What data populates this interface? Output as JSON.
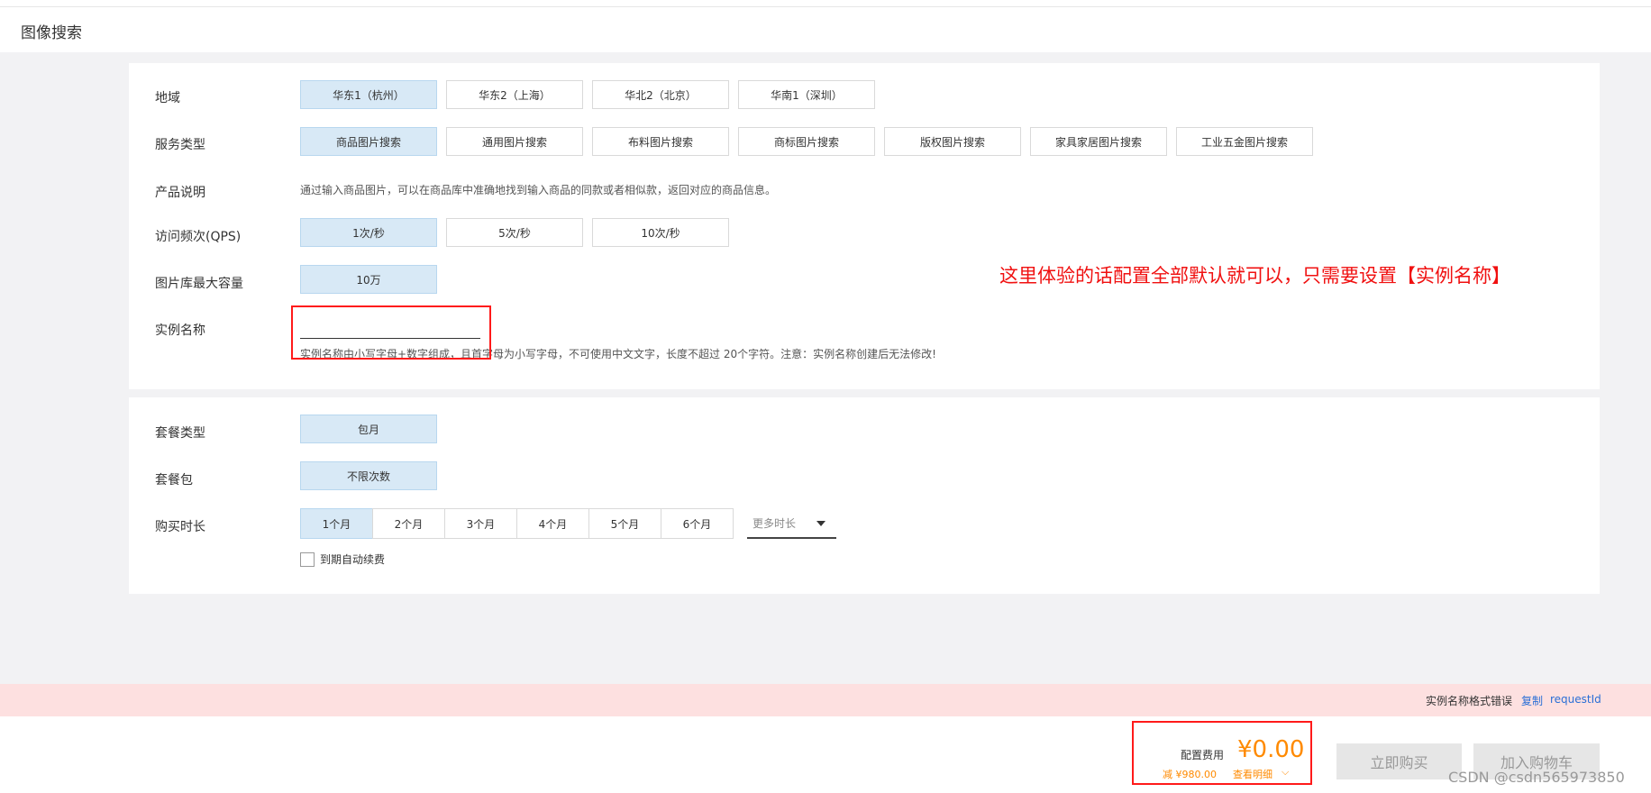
{
  "page": {
    "title": "图像搜索"
  },
  "region": {
    "label": "地域",
    "options": [
      "华东1（杭州）",
      "华东2（上海）",
      "华北2（北京）",
      "华南1（深圳）"
    ]
  },
  "service": {
    "label": "服务类型",
    "options": [
      "商品图片搜索",
      "通用图片搜索",
      "布料图片搜索",
      "商标图片搜索",
      "版权图片搜索",
      "家具家居图片搜索",
      "工业五金图片搜索"
    ]
  },
  "product": {
    "label": "产品说明",
    "description": "通过输入商品图片，可以在商品库中准确地找到输入商品的同款或者相似款，返回对应的商品信息。"
  },
  "qps": {
    "label": "访问频次(QPS)",
    "options": [
      "1次/秒",
      "5次/秒",
      "10次/秒"
    ]
  },
  "capacity": {
    "label": "图片库最大容量",
    "options": [
      "10万"
    ]
  },
  "instance": {
    "label": "实例名称",
    "value": "",
    "hint": "实例名称由小写字母+数字组成，且首字母为小写字母，不可使用中文文字，长度不超过 20个字符。注意：实例名称创建后无法修改!"
  },
  "annotation": {
    "text": "这里体验的话配置全部默认就可以，只需要设置【实例名称】"
  },
  "package_type": {
    "label": "套餐类型",
    "options": [
      "包月"
    ]
  },
  "package": {
    "label": "套餐包",
    "options": [
      "不限次数"
    ]
  },
  "duration": {
    "label": "购买时长",
    "options": [
      "1个月",
      "2个月",
      "3个月",
      "4个月",
      "5个月",
      "6个月"
    ],
    "more": "更多时长",
    "auto_renew": "到期自动续费"
  },
  "error": {
    "message": "实例名称格式错误",
    "copy": "复制",
    "request_id": "requestId"
  },
  "footer": {
    "fee_label": "配置费用",
    "price": "¥0.00",
    "discount": "减 ¥980.00",
    "detail": "查看明细",
    "buy": "立即购买",
    "cart": "加入购物车"
  },
  "watermark": "CSDN @csdn565973850"
}
